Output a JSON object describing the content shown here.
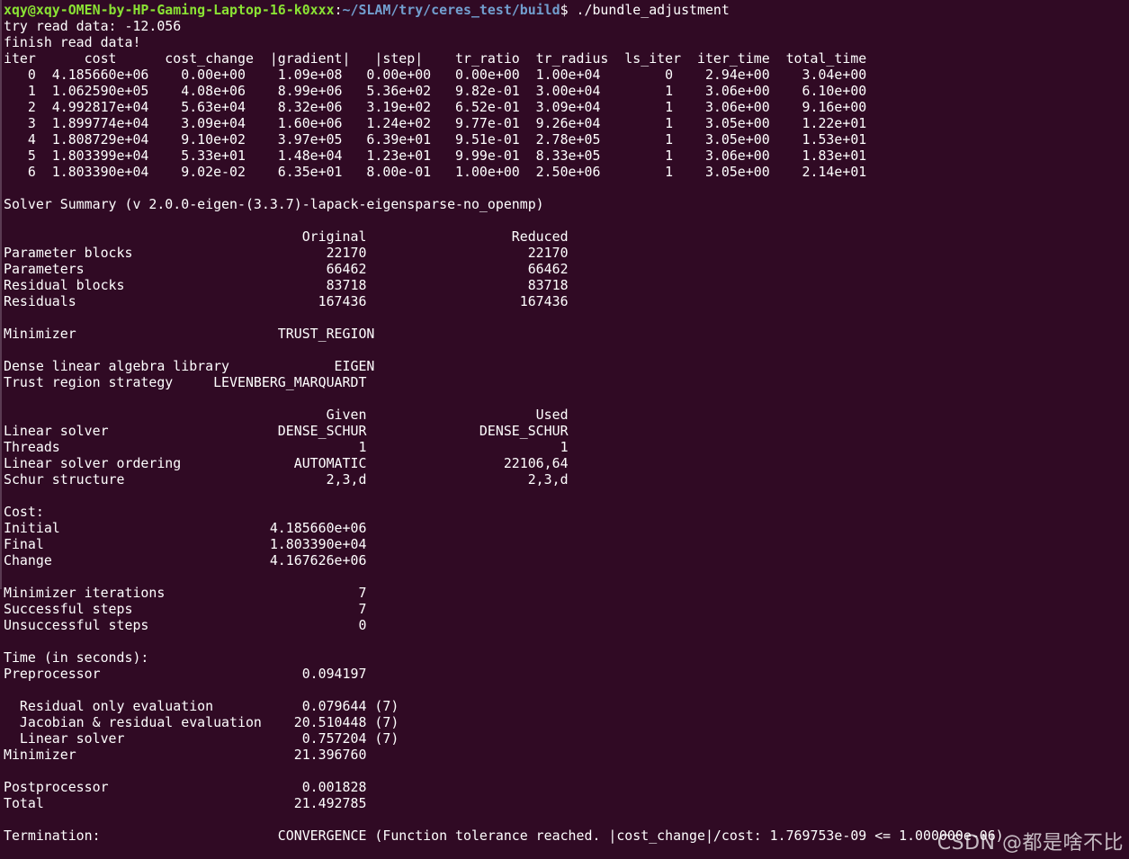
{
  "prompt": {
    "user_host": "xqy@xqy-OMEN-by-HP-Gaming-Laptop-16-k0xxx",
    "separator": ":",
    "path": "~/SLAM/try/ceres_test/build",
    "symbol": "$ ",
    "command": "./bundle_adjustment"
  },
  "output_lines": [
    "try read data: -12.056",
    "finish read data!",
    "iter      cost      cost_change  |gradient|   |step|    tr_ratio  tr_radius  ls_iter  iter_time  total_time",
    "   0  4.185660e+06    0.00e+00    1.09e+08   0.00e+00   0.00e+00  1.00e+04        0    2.94e+00    3.04e+00",
    "   1  1.062590e+05    4.08e+06    8.99e+06   5.36e+02   9.82e-01  3.00e+04        1    3.06e+00    6.10e+00",
    "   2  4.992817e+04    5.63e+04    8.32e+06   3.19e+02   6.52e-01  3.09e+04        1    3.06e+00    9.16e+00",
    "   3  1.899774e+04    3.09e+04    1.60e+06   1.24e+02   9.77e-01  9.26e+04        1    3.05e+00    1.22e+01",
    "   4  1.808729e+04    9.10e+02    3.97e+05   6.39e+01   9.51e-01  2.78e+05        1    3.05e+00    1.53e+01",
    "   5  1.803399e+04    5.33e+01    1.48e+04   1.23e+01   9.99e-01  8.33e+05        1    3.06e+00    1.83e+01",
    "   6  1.803390e+04    9.02e-02    6.35e+01   8.00e-01   1.00e+00  2.50e+06        1    3.05e+00    2.14e+01",
    "",
    "Solver Summary (v 2.0.0-eigen-(3.3.7)-lapack-eigensparse-no_openmp)",
    "",
    "                                     Original                  Reduced",
    "Parameter blocks                        22170                    22170",
    "Parameters                              66462                    66462",
    "Residual blocks                         83718                    83718",
    "Residuals                              167436                   167436",
    "",
    "Minimizer                         TRUST_REGION",
    "",
    "Dense linear algebra library             EIGEN",
    "Trust region strategy     LEVENBERG_MARQUARDT",
    "",
    "                                        Given                     Used",
    "Linear solver                     DENSE_SCHUR              DENSE_SCHUR",
    "Threads                                     1                        1",
    "Linear solver ordering              AUTOMATIC                 22106,64",
    "Schur structure                         2,3,d                    2,3,d",
    "",
    "Cost:",
    "Initial                          4.185660e+06",
    "Final                            1.803390e+04",
    "Change                           4.167626e+06",
    "",
    "Minimizer iterations                        7",
    "Successful steps                            7",
    "Unsuccessful steps                          0",
    "",
    "Time (in seconds):",
    "Preprocessor                         0.094197",
    "",
    "  Residual only evaluation           0.079644 (7)",
    "  Jacobian & residual evaluation    20.510448 (7)",
    "  Linear solver                      0.757204 (7)",
    "Minimizer                           21.396760",
    "",
    "Postprocessor                        0.001828",
    "Total                               21.492785",
    "",
    "Termination:                      CONVERGENCE (Function tolerance reached. |cost_change|/cost: 1.769753e-09 <= 1.000000e-06)"
  ],
  "watermark": "CSDN @都是啥不比",
  "colors": {
    "background": "#300a24",
    "text": "#ffffff",
    "prompt_user": "#8ae234",
    "prompt_path": "#729fcf"
  }
}
